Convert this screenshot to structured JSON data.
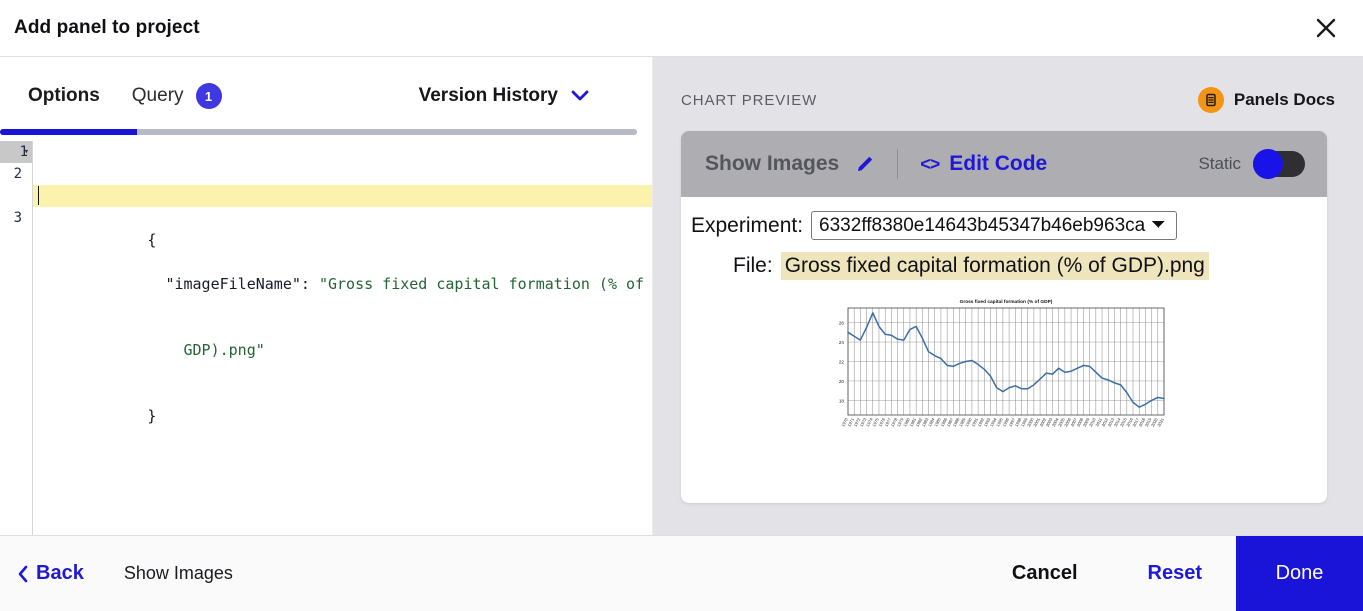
{
  "window": {
    "title": "Add panel to project",
    "close_icon": "close-icon"
  },
  "left_pane": {
    "tabs": [
      {
        "label": "Options",
        "active": true,
        "badge": null
      },
      {
        "label": "Query",
        "active": false,
        "badge": "1"
      }
    ],
    "version_history": {
      "label": "Version History",
      "chevron_icon": "chevron-down-icon"
    },
    "editor": {
      "line_numbers": [
        "1",
        "2",
        "3"
      ],
      "fold_marker": "▾",
      "lines": [
        {
          "n": 1,
          "open_brace": "{"
        },
        {
          "n": 2,
          "key": "\"imageFileName\"",
          "colon": ":",
          "value_part1": "\"Gross fixed capital formation (% of",
          "value_part2": "GDP).png\""
        },
        {
          "n": 3,
          "close_brace": "}"
        }
      ]
    }
  },
  "right_pane": {
    "section_label": "CHART PREVIEW",
    "docs_link": {
      "label": "Panels Docs",
      "icon": "book-icon"
    },
    "panel": {
      "title": "Show Images",
      "edit_icon": "pencil-icon",
      "edit_code": {
        "label": "Edit Code",
        "icon": "code-brackets-icon"
      },
      "static_toggle": {
        "label": "Static",
        "state": "off"
      },
      "experiment": {
        "label": "Experiment:",
        "value": "6332ff8380e14643b45347b46eb963ca",
        "options": [
          "6332ff8380e14643b45347b46eb963ca"
        ],
        "chevron_icon": "chevron-down-icon"
      },
      "file": {
        "label": "File:",
        "value": "Gross fixed capital formation (% of GDP).png"
      }
    }
  },
  "footer": {
    "back": {
      "label": "Back",
      "icon": "chevron-left-icon"
    },
    "subtitle": "Show Images",
    "cancel_label": "Cancel",
    "reset_label": "Reset",
    "done_label": "Done"
  },
  "colors": {
    "accent_blue": "#1a13d8",
    "brand_orange": "#f39417",
    "panel_gray": "#aeaeb2",
    "right_bg": "#e3e3e7",
    "highlight_yellow": "#fbf3ac",
    "file_highlight": "#efe5bd",
    "chart_line": "#3a6ea5"
  },
  "chart_data": {
    "type": "line",
    "title": "Gross fixed capital formation (% of GDP)",
    "xlabel": "",
    "ylabel": "",
    "ylim": [
      16.5,
      27.5
    ],
    "yticks": [
      18,
      20,
      22,
      24,
      26
    ],
    "grid": true,
    "legend": false,
    "x": [
      "1970",
      "1971",
      "1972",
      "1973",
      "1974",
      "1975",
      "1976",
      "1977",
      "1978",
      "1979",
      "1980",
      "1981",
      "1982",
      "1983",
      "1984",
      "1985",
      "1986",
      "1987",
      "1988",
      "1989",
      "1990",
      "1991",
      "1992",
      "1993",
      "1994",
      "1995",
      "1996",
      "1997",
      "1998",
      "1999",
      "2000",
      "2001",
      "2002",
      "2003",
      "2004",
      "2005",
      "2006",
      "2007",
      "2008",
      "2009",
      "2010",
      "2011",
      "2012",
      "2013",
      "2014",
      "2015",
      "2016",
      "2017",
      "2018",
      "2019",
      "2020",
      "2021"
    ],
    "series": [
      {
        "name": "Gross fixed capital formation (% of GDP)",
        "values": [
          25.0,
          24.6,
          24.2,
          25.5,
          27.0,
          25.6,
          24.8,
          24.7,
          24.3,
          24.2,
          25.3,
          25.6,
          24.4,
          23.0,
          22.6,
          22.3,
          21.6,
          21.5,
          21.8,
          22.0,
          22.1,
          21.7,
          21.2,
          20.5,
          19.3,
          18.9,
          19.3,
          19.5,
          19.2,
          19.2,
          19.6,
          20.2,
          20.8,
          20.7,
          21.3,
          20.9,
          21.0,
          21.3,
          21.6,
          21.5,
          20.9,
          20.3,
          20.1,
          19.8,
          19.6,
          18.8,
          17.8,
          17.3,
          17.6,
          18.0,
          18.3,
          18.2
        ]
      }
    ]
  }
}
